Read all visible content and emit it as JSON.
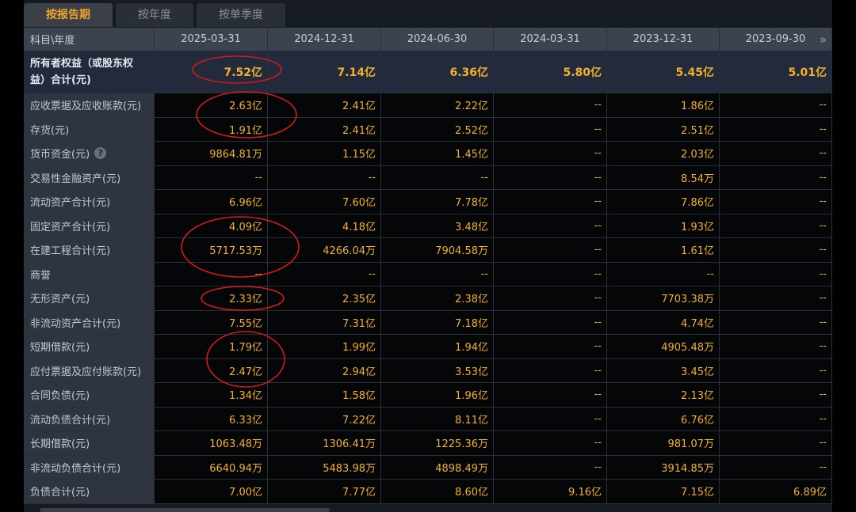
{
  "tabs": [
    {
      "label": "按报告期",
      "active": true
    },
    {
      "label": "按年度",
      "active": false
    },
    {
      "label": "按单季度",
      "active": false
    }
  ],
  "header": {
    "label_col": "科目\\年度",
    "periods": [
      "2025-03-31",
      "2024-12-31",
      "2024-06-30",
      "2024-03-31",
      "2023-12-31",
      "2023-09-30"
    ]
  },
  "rows": [
    {
      "label": "所有者权益（或股东权益）合计(元)",
      "values": [
        "7.52亿",
        "7.14亿",
        "6.36亿",
        "5.80亿",
        "5.45亿",
        "5.01亿"
      ]
    },
    {
      "label": "应收票据及应收账款(元)",
      "values": [
        "2.63亿",
        "2.41亿",
        "2.22亿",
        "--",
        "1.86亿",
        "--"
      ]
    },
    {
      "label": "存货(元)",
      "values": [
        "1.91亿",
        "2.41亿",
        "2.52亿",
        "--",
        "2.51亿",
        "--"
      ]
    },
    {
      "label": "货币资金(元)",
      "values": [
        "9864.81万",
        "1.15亿",
        "1.45亿",
        "--",
        "2.03亿",
        "--"
      ],
      "help": true
    },
    {
      "label": "交易性金融资产(元)",
      "values": [
        "--",
        "--",
        "--",
        "--",
        "8.54万",
        "--"
      ]
    },
    {
      "label": "流动资产合计(元)",
      "values": [
        "6.96亿",
        "7.60亿",
        "7.78亿",
        "--",
        "7.86亿",
        "--"
      ]
    },
    {
      "label": "固定资产合计(元)",
      "values": [
        "4.09亿",
        "4.18亿",
        "3.48亿",
        "--",
        "1.93亿",
        "--"
      ]
    },
    {
      "label": "在建工程合计(元)",
      "values": [
        "5717.53万",
        "4266.04万",
        "7904.58万",
        "--",
        "1.61亿",
        "--"
      ]
    },
    {
      "label": "商誉",
      "values": [
        "--",
        "--",
        "--",
        "--",
        "--",
        "--"
      ]
    },
    {
      "label": "无形资产(元)",
      "values": [
        "2.33亿",
        "2.35亿",
        "2.38亿",
        "--",
        "7703.38万",
        "--"
      ]
    },
    {
      "label": "非流动资产合计(元)",
      "values": [
        "7.55亿",
        "7.31亿",
        "7.18亿",
        "--",
        "4.74亿",
        "--"
      ]
    },
    {
      "label": "短期借款(元)",
      "values": [
        "1.79亿",
        "1.99亿",
        "1.94亿",
        "--",
        "4905.48万",
        "--"
      ]
    },
    {
      "label": "应付票据及应付账款(元)",
      "values": [
        "2.47亿",
        "2.94亿",
        "3.53亿",
        "--",
        "3.45亿",
        "--"
      ]
    },
    {
      "label": "合同负债(元)",
      "values": [
        "1.34亿",
        "1.58亿",
        "1.96亿",
        "--",
        "2.13亿",
        "--"
      ]
    },
    {
      "label": "流动负债合计(元)",
      "values": [
        "6.33亿",
        "7.22亿",
        "8.11亿",
        "--",
        "6.76亿",
        "--"
      ]
    },
    {
      "label": "长期借款(元)",
      "values": [
        "1063.48万",
        "1306.41万",
        "1225.36万",
        "--",
        "981.07万",
        "--"
      ]
    },
    {
      "label": "非流动负债合计(元)",
      "values": [
        "6640.94万",
        "5483.98万",
        "4898.49万",
        "--",
        "3914.85万",
        "--"
      ]
    },
    {
      "label": "负债合计(元)",
      "values": [
        "7.00亿",
        "7.77亿",
        "8.60亿",
        "9.16亿",
        "7.15亿",
        "6.89亿"
      ]
    }
  ],
  "icons": {
    "help": "help-circle-icon",
    "next": "double-chevron-right-icon"
  },
  "colors": {
    "value_text": "#f3b12c",
    "active_tab_text": "#f1a52c",
    "annotation": "#d11a1a"
  }
}
